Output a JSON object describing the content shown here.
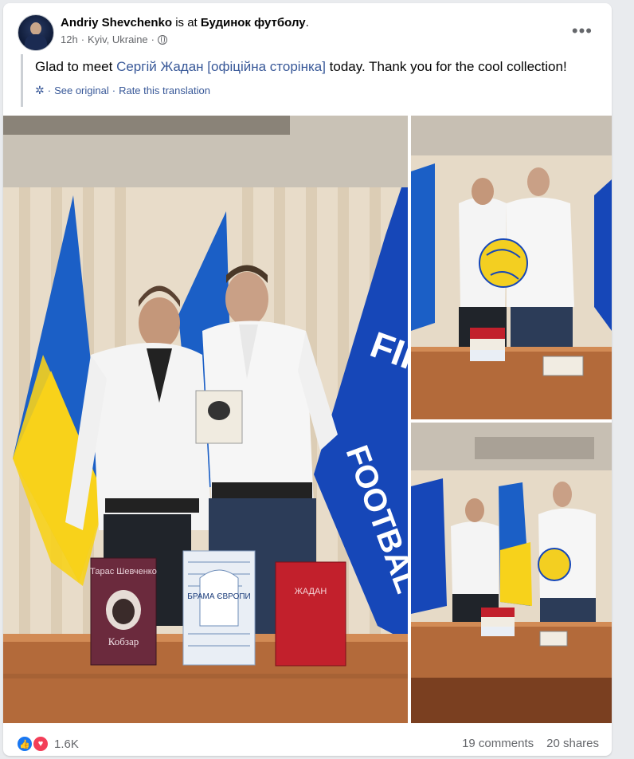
{
  "post": {
    "author": "Andriy Shevchenko",
    "is_at": "is at",
    "place": "Будинок футболу",
    "period": ".",
    "time": "12h",
    "location": "Kyiv, Ukraine",
    "separator": "·",
    "text_before": "Glad to meet ",
    "mention": "Сергій Жадан [офіційна сторінка]",
    "text_after": " today. Thank you for the cool collection!",
    "see_original": "See original",
    "translate_sep": "·",
    "rate_translation": "Rate this translation"
  },
  "photos": {
    "main": {
      "books": [
        "Тарас Шевченко",
        "Кобзар",
        "БРАМА ЄВРОПИ",
        "ЖАДАН"
      ]
    },
    "flag_text": "FIFA",
    "flag_text2": "FOOTBAL"
  },
  "footer": {
    "reaction_count": "1.6K",
    "comments": "19 comments",
    "shares": "20 shares"
  },
  "icons": {
    "more": "more-options-icon",
    "globe": "globe-icon",
    "gear": "gear-icon",
    "like": "like-icon",
    "love": "love-icon"
  },
  "colors": {
    "link": "#385898",
    "like": "#1877f2",
    "love": "#f33e58"
  }
}
